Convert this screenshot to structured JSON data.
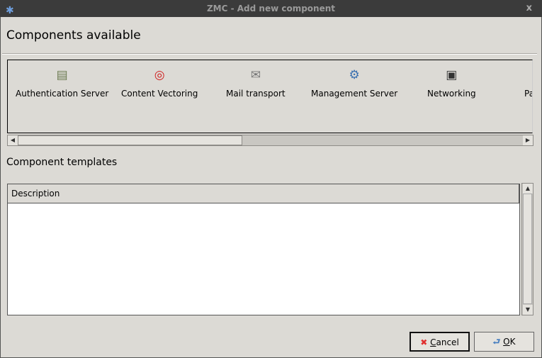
{
  "window": {
    "title": "ZMC - Add new component",
    "app_icon": "zarafa-icon",
    "close_label": "x"
  },
  "components_heading": "Components available",
  "components": [
    {
      "label": "Authentication Server",
      "icon": "id-card-icon",
      "glyph": "🪪"
    },
    {
      "label": "Content Vectoring",
      "icon": "target-icon",
      "glyph": "◎"
    },
    {
      "label": "Mail transport",
      "icon": "envelope-icon",
      "glyph": "✉"
    },
    {
      "label": "Management Server",
      "icon": "gear-icon",
      "glyph": "⚙"
    },
    {
      "label": "Networking",
      "icon": "network-device-icon",
      "glyph": "▣"
    },
    {
      "label": "Pa",
      "icon": "",
      "glyph": ""
    }
  ],
  "templates_heading": "Component templates",
  "table": {
    "columns": [
      "Description"
    ],
    "rows": []
  },
  "buttons": {
    "cancel_rest": "ancel",
    "cancel_mnemonic": "C",
    "ok_mnemonic": "O",
    "ok_rest": "K"
  }
}
